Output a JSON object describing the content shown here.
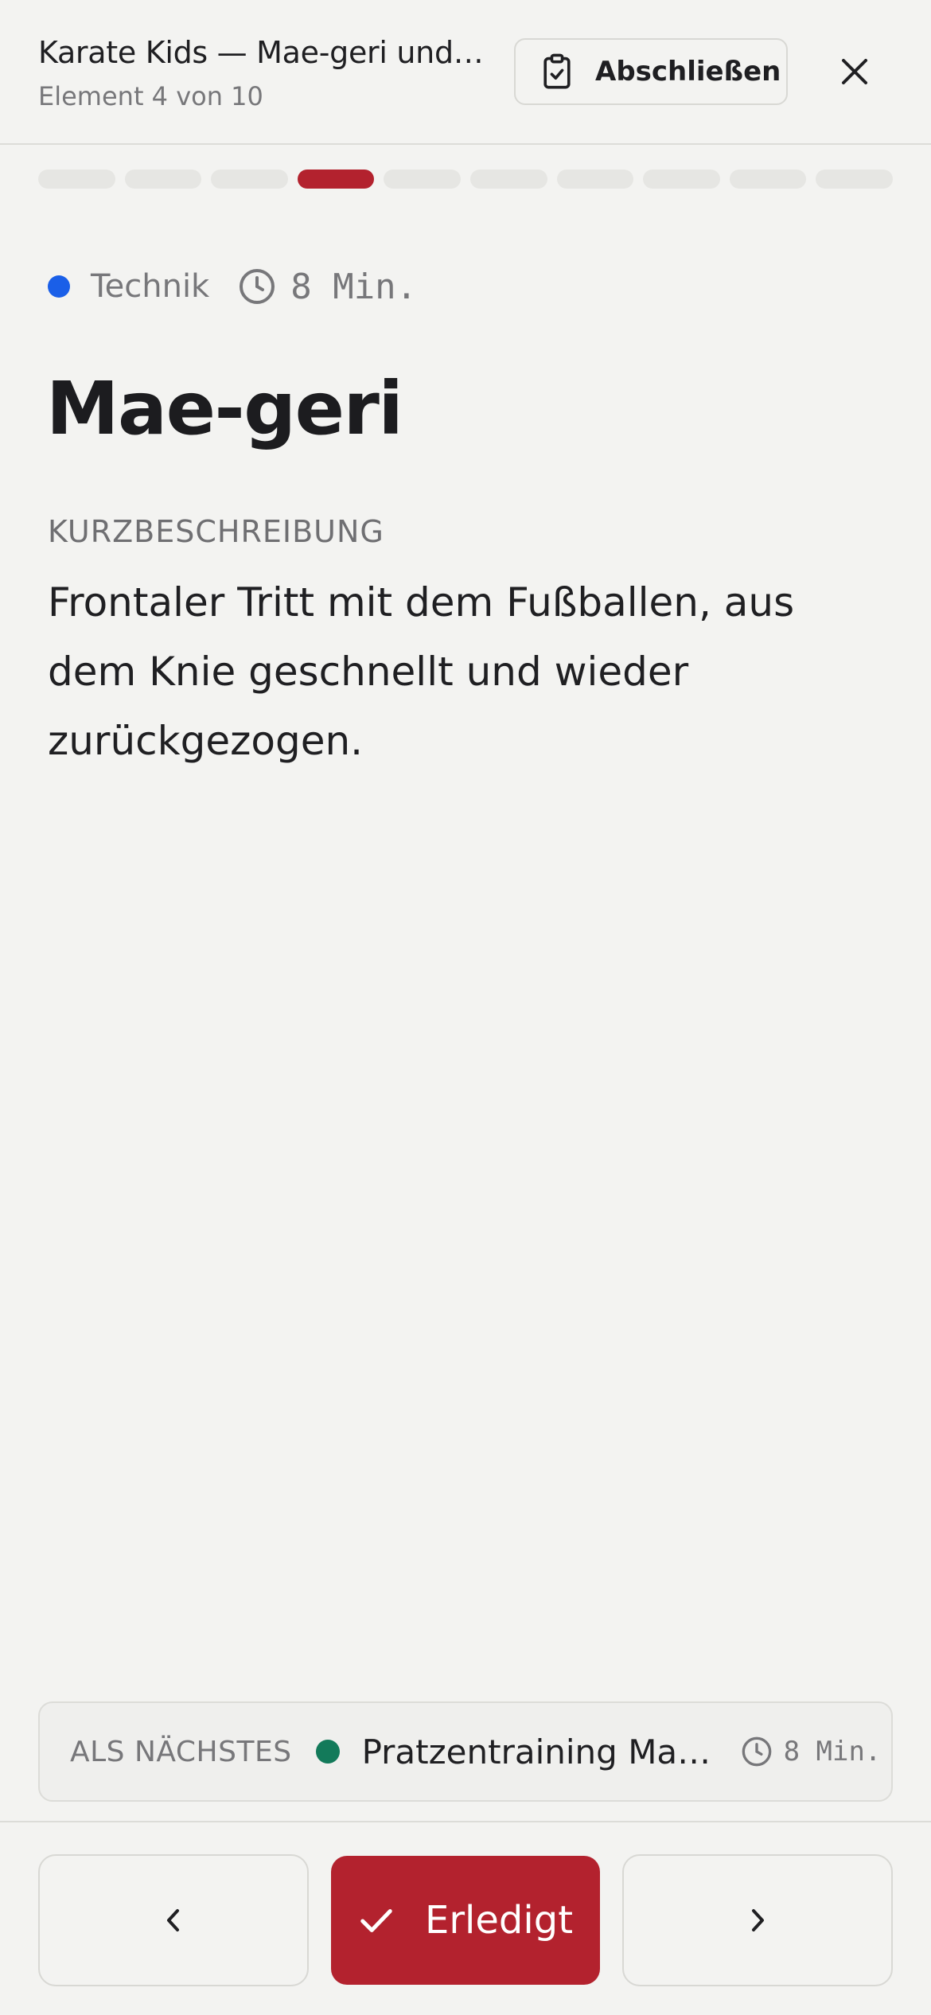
{
  "header": {
    "title": "Karate Kids — Mae-geri und …",
    "subtitle": "Element 4 von 10",
    "finish_label": "Abschließen"
  },
  "progress": {
    "total": 10,
    "current": 4
  },
  "item": {
    "category": "Technik",
    "category_color": "#1a5fe8",
    "duration": "8 Min.",
    "title": "Mae-geri",
    "section_label": "KURZBESCHREIBUNG",
    "description": "Frontaler Tritt mit dem Fußballen, aus dem Knie geschnellt und wieder zurückgezogen."
  },
  "next": {
    "label": "ALS NÄCHSTES",
    "title": "Pratzentraining Mae-g...",
    "color": "#137a5a",
    "duration": "8 Min."
  },
  "footer": {
    "done_label": "Erledigt"
  },
  "colors": {
    "accent": "#b3222e",
    "background": "#f3f3f1"
  },
  "icons": {
    "finish": "clipboard-check-icon",
    "close": "close-icon",
    "duration": "clock-icon",
    "prev": "chevron-left-icon",
    "next": "chevron-right-icon",
    "done": "check-icon"
  }
}
